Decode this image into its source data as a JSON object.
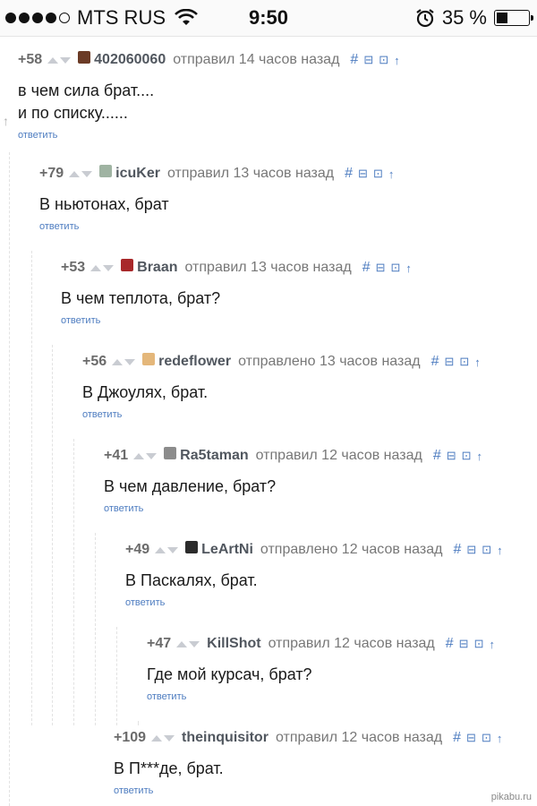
{
  "status": {
    "carrier": "MTS RUS",
    "time": "9:50",
    "battery_label": "35 %",
    "battery_level": 0.35
  },
  "comments": [
    {
      "rating": "+58",
      "author": "402060060",
      "when": "отправил 14 часов назад",
      "lines": [
        "в чем сила брат....",
        "и по списку......"
      ],
      "reply": "ответить",
      "avatar_color": "#6b3b26"
    },
    {
      "rating": "+79",
      "author": "icuKer",
      "when": "отправил 13 часов назад",
      "lines": [
        "В ньютонах, брат"
      ],
      "reply": "ответить",
      "avatar_color": "#9fb3a2"
    },
    {
      "rating": "+53",
      "author": "Braan",
      "when": "отправил 13 часов назад",
      "lines": [
        "В чем теплота, брат?"
      ],
      "reply": "ответить",
      "avatar_color": "#a8282a"
    },
    {
      "rating": "+56",
      "author": "redeflower",
      "when": "отправлено 13 часов назад",
      "lines": [
        "В Джоулях, брат."
      ],
      "reply": "ответить",
      "avatar_color": "#e4b77a"
    },
    {
      "rating": "+41",
      "author": "Ra5taman",
      "when": "отправил 12 часов назад",
      "lines": [
        "В чем давление, брат?"
      ],
      "reply": "ответить",
      "avatar_color": "#8c8c8c"
    },
    {
      "rating": "+49",
      "author": "LeArtNi",
      "when": "отправлено 12 часов назад",
      "lines": [
        "В Паскалях, брат."
      ],
      "reply": "ответить",
      "avatar_color": "#2b2b2b"
    },
    {
      "rating": "+47",
      "author": "KillShot",
      "when": "отправил 12 часов назад",
      "lines": [
        "Где мой курсач, брат?"
      ],
      "reply": "ответить",
      "avatar_color": null
    },
    {
      "rating": "+109",
      "author": "theinquisitor",
      "when": "отправил 12 часов назад",
      "lines": [
        "В П***де, брат."
      ],
      "reply": "ответить",
      "avatar_color": null
    }
  ],
  "actions": {
    "hash": "#",
    "collapse": "⊟",
    "save": "⊡",
    "up": "↑"
  },
  "watermark": "pikabu.ru",
  "colors": {
    "link": "#4d7cc0",
    "rating": "#6b6b6b",
    "author": "#51575f"
  }
}
